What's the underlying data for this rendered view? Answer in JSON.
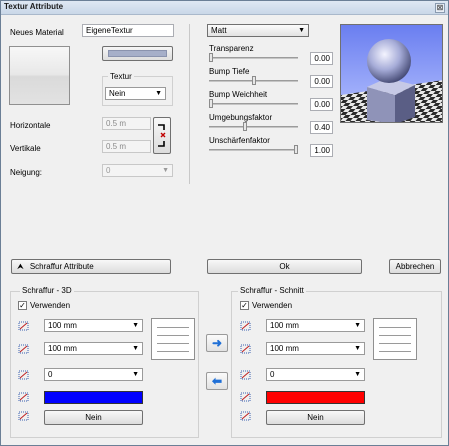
{
  "window": {
    "title": "Textur Attribute",
    "close_glyph": "⊠"
  },
  "material": {
    "label": "Neues Material",
    "value": "EigeneTextur",
    "textur_group_label": "Textur",
    "textur_value": "Nein"
  },
  "position": {
    "horizontale_label": "Horizontale",
    "horizontale_value": "0.5 m",
    "vertikale_label": "Vertikale",
    "vertikale_value": "0.5 m",
    "neigung_label": "Neigung:",
    "neigung_value": "0"
  },
  "surface": {
    "mode_value": "Matt",
    "sliders": [
      {
        "label": "Transparenz",
        "value": "0.00",
        "level": 0.0
      },
      {
        "label": "Bump Tiefe",
        "value": "0.00",
        "level": 0.5
      },
      {
        "label": "Bump Weichheit",
        "value": "0.00",
        "level": 0.0
      },
      {
        "label": "Umgebungsfaktor",
        "value": "0.40",
        "level": 0.4
      },
      {
        "label": "Unschärfenfaktor",
        "value": "1.00",
        "level": 1.0
      }
    ]
  },
  "actions": {
    "schraffur_attribute": "Schraffur Attribute",
    "ok": "Ok",
    "abbrechen": "Abbrechen"
  },
  "hatch_3d": {
    "title": "Schraffur - 3D",
    "verwenden_label": "Verwenden",
    "checked": true,
    "size1": "100 mm",
    "size2": "100 mm",
    "angle": "0",
    "color": "#0000ff",
    "nein_label": "Nein"
  },
  "hatch_cut": {
    "title": "Schraffur - Schnitt",
    "verwenden_label": "Verwenden",
    "checked": true,
    "size1": "100 mm",
    "size2": "100 mm",
    "angle": "0",
    "color": "#ff0000",
    "nein_label": "Nein"
  },
  "transfer": {
    "right_glyph": "➜",
    "left_glyph": "⬅"
  },
  "glyphs": {
    "dropdown": "▼",
    "check": "✓",
    "double_up": "⮝"
  }
}
